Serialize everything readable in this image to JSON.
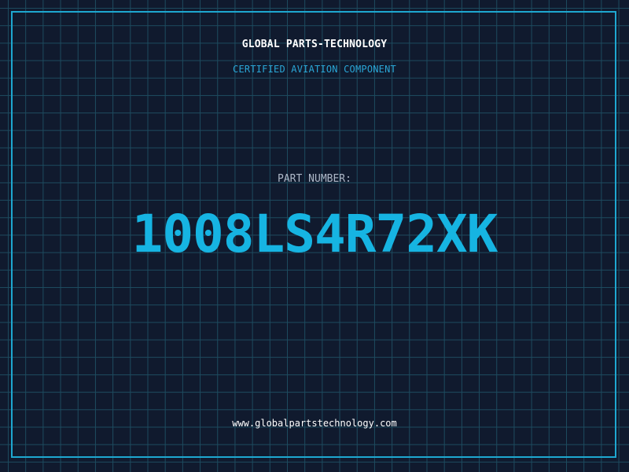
{
  "header": {
    "brand": "GLOBAL PARTS-TECHNOLOGY",
    "subtitle": "CERTIFIED AVIATION COMPONENT"
  },
  "part": {
    "label": "PART NUMBER:",
    "number": "1008LS4R72XK"
  },
  "footer": {
    "url": "www.globalpartstechnology.com"
  },
  "colors": {
    "background": "#101a2e",
    "grid": "#1d4b5f",
    "frame": "#1ea7d0",
    "accent": "#16b4e2",
    "subtitle": "#2aa6d6",
    "label": "#aeb8c8",
    "text": "#ffffff"
  }
}
